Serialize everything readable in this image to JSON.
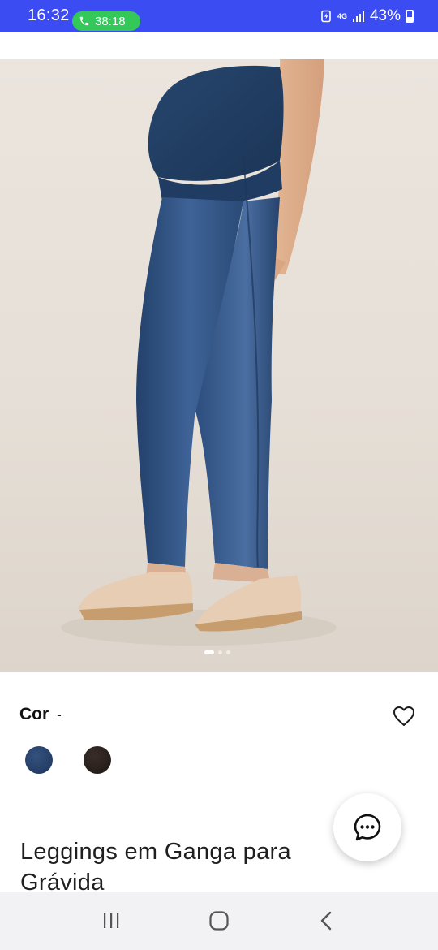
{
  "status_bar": {
    "time": "16:32",
    "call_timer": "38:18",
    "network": "4G",
    "battery": "43%",
    "bg_color": "#3b4cf2"
  },
  "product_image": {
    "icon": "product-photo",
    "slides_total": 3,
    "active_slide": 1
  },
  "product": {
    "color_label": "Cor",
    "color_value": "-",
    "swatches": [
      {
        "name": "denim-blue",
        "color": "#2a4570"
      },
      {
        "name": "dark-brown",
        "color": "#2b211d"
      }
    ],
    "title": "Leggings em Ganga para Grávida"
  },
  "chat": {
    "icon": "chat-bubble-icon"
  },
  "nav_bar": {
    "buttons": [
      "recent-apps-icon",
      "home-icon",
      "back-icon"
    ]
  }
}
